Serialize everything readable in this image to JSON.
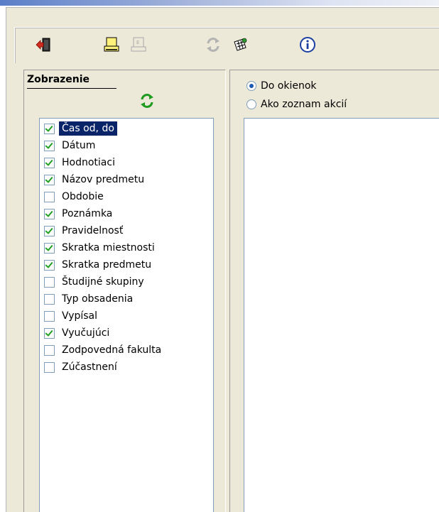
{
  "toolbar": {
    "buttons": [
      {
        "icon": "exit-door-icon"
      },
      {
        "icon": "printer-icon"
      },
      {
        "icon": "print-preview-disabled-icon"
      },
      {
        "icon": "refresh-disabled-icon"
      },
      {
        "icon": "calendar-settings-icon"
      },
      {
        "icon": "info-icon"
      }
    ]
  },
  "display_panel": {
    "title": "Zobrazenie",
    "items": [
      {
        "label": "Čas od, do",
        "checked": true,
        "selected": true
      },
      {
        "label": "Dátum",
        "checked": true
      },
      {
        "label": "Hodnotiaci",
        "checked": true
      },
      {
        "label": "Názov predmetu",
        "checked": true
      },
      {
        "label": "Obdobie",
        "checked": false
      },
      {
        "label": "Poznámka",
        "checked": true
      },
      {
        "label": "Pravidelnosť",
        "checked": true
      },
      {
        "label": "Skratka miestnosti",
        "checked": true
      },
      {
        "label": "Skratka predmetu",
        "checked": true
      },
      {
        "label": "Študijné skupiny",
        "checked": false
      },
      {
        "label": "Typ obsadenia",
        "checked": false
      },
      {
        "label": "Vypísal",
        "checked": false
      },
      {
        "label": "Vyučujúci",
        "checked": true
      },
      {
        "label": "Zodpovedná fakulta",
        "checked": false
      },
      {
        "label": "Zúčastnení",
        "checked": false
      }
    ]
  },
  "view_mode": {
    "options": [
      {
        "label": "Do okienok",
        "selected": true
      },
      {
        "label": "Ako zoznam akcií",
        "selected": false
      }
    ]
  },
  "colors": {
    "selection": "#0a246a",
    "window_bg": "#ece9d8",
    "check": "#21a121"
  }
}
